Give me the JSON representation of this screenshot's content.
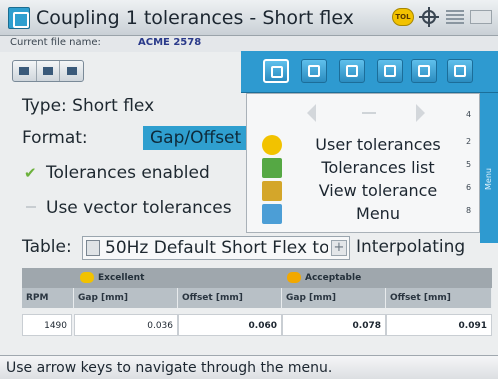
{
  "titlebar": {
    "title": "Coupling 1 tolerances - Short flex",
    "tol_badge": "TOL",
    "icons": [
      "app-icon",
      "tol-badge-icon",
      "crosshair-icon",
      "grid-icon",
      "battery-icon"
    ]
  },
  "file": {
    "label": "Current file name:",
    "value": "ACME 2578"
  },
  "form": {
    "type_label": "Type: Short flex",
    "format_label": "Format:",
    "format_value": "Gap/Offset",
    "tolerances_enabled_label": "Tolerances enabled",
    "tolerances_enabled": true,
    "vector_tolerances_label": "Use vector tolerances",
    "vector_tolerances": false,
    "table_label": "Table:",
    "table_value": "50Hz Default Short Flex to",
    "interpolating_label": "Interpolating"
  },
  "menu": {
    "toolbar_icons": [
      "coupling-icon",
      "grid-icon",
      "info-icon",
      "graph-icon",
      "wave-icon",
      "settings-icon"
    ],
    "selected_toolbar_index": 0,
    "nav_dash": "-",
    "items": [
      {
        "label": "User tolerances",
        "key": "2",
        "icon": "user-tolerances-icon",
        "color": "#f2c200"
      },
      {
        "label": "Tolerances list",
        "key": "5",
        "icon": "tolerances-list-icon",
        "color": "#55a844"
      },
      {
        "label": "View tolerance",
        "key": "6",
        "icon": "view-tolerance-icon",
        "color": "#d4a62a"
      },
      {
        "label": "Menu",
        "key": "8",
        "icon": "menu-icon",
        "color": "#4c9ed6"
      }
    ],
    "top_key": "4",
    "edge_label": "Menu"
  },
  "table": {
    "groups": [
      {
        "label": "Excellent",
        "color": "#f2c200"
      },
      {
        "label": "Acceptable",
        "color": "#f2a800"
      }
    ],
    "columns": [
      "RPM",
      "Gap [mm]",
      "Offset [mm]",
      "Gap [mm]",
      "Offset [mm]"
    ],
    "rows": [
      {
        "rpm": "1490",
        "exc_gap": "0.036",
        "exc_offset": "0.060",
        "acc_gap": "0.078",
        "acc_offset": "0.091"
      }
    ]
  },
  "status": {
    "text": "Use arrow keys to navigate through the menu."
  }
}
